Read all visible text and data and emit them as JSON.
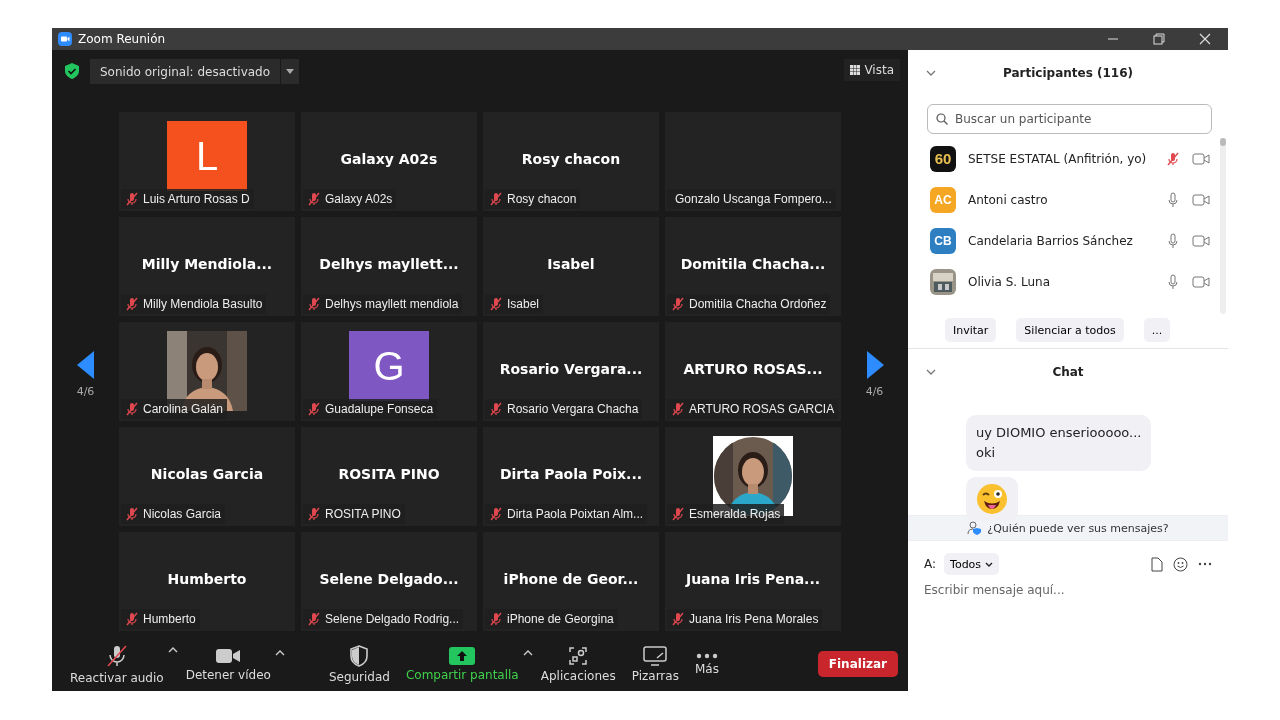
{
  "window": {
    "title": "Zoom Reunión"
  },
  "top_bar": {
    "original_sound": "Sonido original: desactivado",
    "view": "Vista"
  },
  "page_left": "4/6",
  "page_right": "4/6",
  "tiles": [
    {
      "kind": "avatar",
      "letter": "L",
      "color": "#f4511e",
      "label": "Luis Arturo Rosas D",
      "muted": true
    },
    {
      "kind": "name",
      "display": "Galaxy A02s",
      "label": "Galaxy A02s",
      "muted": true
    },
    {
      "kind": "name",
      "display": "Rosy chacon",
      "label": "Rosy chacon",
      "muted": true
    },
    {
      "kind": "blank",
      "label": "Gonzalo Uscanga Fompero...",
      "muted": false
    },
    {
      "kind": "name",
      "display": "Milly  Mendiola...",
      "label": "Milly Mendiola Basulto",
      "muted": true
    },
    {
      "kind": "name",
      "display": "Delhys  mayllett...",
      "label": "Delhys mayllett mendiola",
      "muted": true
    },
    {
      "kind": "name",
      "display": "Isabel",
      "label": "Isabel",
      "muted": true
    },
    {
      "kind": "name",
      "display": "Domitila  Chacha...",
      "label": "Domitila Chacha Ordoñez",
      "muted": true
    },
    {
      "kind": "picture",
      "label": "Carolina Galán",
      "muted": true
    },
    {
      "kind": "avatar",
      "letter": "G",
      "color": "#7e57c2",
      "label": "Guadalupe Fonseca",
      "muted": true
    },
    {
      "kind": "name",
      "display": "Rosario  Vergara...",
      "label": "Rosario Vergara Chacha",
      "muted": true
    },
    {
      "kind": "name",
      "display": "ARTURO  ROSAS...",
      "label": "ARTURO ROSAS GARCIA",
      "muted": true
    },
    {
      "kind": "name",
      "display": "Nicolas Garcia",
      "label": "Nicolas Garcia",
      "muted": true
    },
    {
      "kind": "name",
      "display": "ROSITA PINO",
      "label": "ROSITA PINO",
      "muted": true
    },
    {
      "kind": "name",
      "display": "Dirta  Paola  Poix...",
      "label": "Dirta Paola Poixtan Alm...",
      "muted": true
    },
    {
      "kind": "round_picture",
      "label": "Esmeralda Rojas",
      "muted": true
    },
    {
      "kind": "name",
      "display": "Humberto",
      "label": "Humberto",
      "muted": true
    },
    {
      "kind": "name",
      "display": "Selene  Delgado...",
      "label": "Selene Delgado Rodrig...",
      "muted": true
    },
    {
      "kind": "name",
      "display": "iPhone  de  Geor...",
      "label": "iPhone de Georgina",
      "muted": true
    },
    {
      "kind": "name",
      "display": "Juana Iris Pena...",
      "label": "Juana Iris Pena Morales",
      "muted": true
    }
  ],
  "toolbar": [
    {
      "kind": "mic_off",
      "label": "Reactivar audio",
      "caret": true,
      "highlight": false
    },
    {
      "kind": "camera",
      "label": "Detener vídeo",
      "caret": true,
      "highlight": false
    },
    {
      "kind": "shield",
      "label": "Seguridad",
      "caret": false,
      "highlight": false
    },
    {
      "kind": "share",
      "label": "Compartir pantalla",
      "caret": true,
      "highlight": true
    },
    {
      "kind": "apps",
      "label": "Aplicaciones",
      "caret": false,
      "highlight": false
    },
    {
      "kind": "whiteboard",
      "label": "Pizarras",
      "caret": false,
      "highlight": false
    },
    {
      "kind": "more",
      "label": "Más",
      "caret": false,
      "highlight": false
    }
  ],
  "end_button": "Finalizar",
  "participants": {
    "title": "Participantes (116)",
    "search_placeholder": "Buscar un participante",
    "items": [
      {
        "kind": "badge",
        "initials": "60",
        "name": "SETSE ESTATAL (Anfitrión, yo)",
        "muted": true
      },
      {
        "kind": "initials",
        "initials": "AC",
        "color": "#f5a623",
        "name": "Antoni castro",
        "muted": false
      },
      {
        "kind": "initials",
        "initials": "CB",
        "color": "#2d7fc1",
        "name": "Candelaria Barrios Sánchez",
        "muted": false
      },
      {
        "kind": "picture",
        "name": "Olivia S. Luna",
        "muted": false
      }
    ],
    "buttons": [
      "Invitar",
      "Silenciar a todos",
      "..."
    ]
  },
  "chat": {
    "title": "Chat",
    "messages": [
      {
        "kind": "text",
        "text": "uy DIOMIO enseriooooo...\noki"
      },
      {
        "kind": "emoji"
      }
    ],
    "privacy": "¿Quién puede ver sus mensajes?",
    "to_label": "A:",
    "to_value": "Todos",
    "placeholder": "Escribir mensaje aquí..."
  }
}
